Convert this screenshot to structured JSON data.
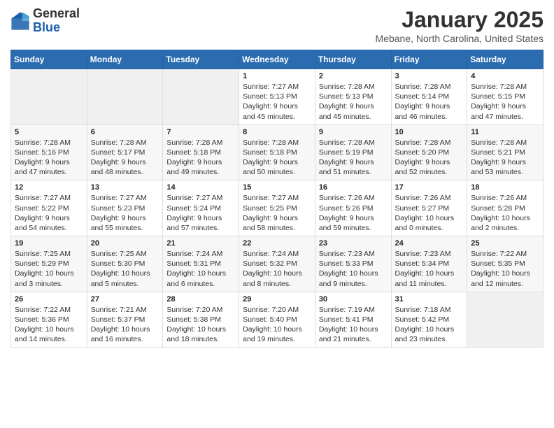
{
  "logo": {
    "general": "General",
    "blue": "Blue"
  },
  "header": {
    "title": "January 2025",
    "location": "Mebane, North Carolina, United States"
  },
  "weekdays": [
    "Sunday",
    "Monday",
    "Tuesday",
    "Wednesday",
    "Thursday",
    "Friday",
    "Saturday"
  ],
  "weeks": [
    [
      {
        "day": "",
        "info": ""
      },
      {
        "day": "",
        "info": ""
      },
      {
        "day": "",
        "info": ""
      },
      {
        "day": "1",
        "info": "Sunrise: 7:27 AM\nSunset: 5:13 PM\nDaylight: 9 hours and 45 minutes."
      },
      {
        "day": "2",
        "info": "Sunrise: 7:28 AM\nSunset: 5:13 PM\nDaylight: 9 hours and 45 minutes."
      },
      {
        "day": "3",
        "info": "Sunrise: 7:28 AM\nSunset: 5:14 PM\nDaylight: 9 hours and 46 minutes."
      },
      {
        "day": "4",
        "info": "Sunrise: 7:28 AM\nSunset: 5:15 PM\nDaylight: 9 hours and 47 minutes."
      }
    ],
    [
      {
        "day": "5",
        "info": "Sunrise: 7:28 AM\nSunset: 5:16 PM\nDaylight: 9 hours and 47 minutes."
      },
      {
        "day": "6",
        "info": "Sunrise: 7:28 AM\nSunset: 5:17 PM\nDaylight: 9 hours and 48 minutes."
      },
      {
        "day": "7",
        "info": "Sunrise: 7:28 AM\nSunset: 5:18 PM\nDaylight: 9 hours and 49 minutes."
      },
      {
        "day": "8",
        "info": "Sunrise: 7:28 AM\nSunset: 5:18 PM\nDaylight: 9 hours and 50 minutes."
      },
      {
        "day": "9",
        "info": "Sunrise: 7:28 AM\nSunset: 5:19 PM\nDaylight: 9 hours and 51 minutes."
      },
      {
        "day": "10",
        "info": "Sunrise: 7:28 AM\nSunset: 5:20 PM\nDaylight: 9 hours and 52 minutes."
      },
      {
        "day": "11",
        "info": "Sunrise: 7:28 AM\nSunset: 5:21 PM\nDaylight: 9 hours and 53 minutes."
      }
    ],
    [
      {
        "day": "12",
        "info": "Sunrise: 7:27 AM\nSunset: 5:22 PM\nDaylight: 9 hours and 54 minutes."
      },
      {
        "day": "13",
        "info": "Sunrise: 7:27 AM\nSunset: 5:23 PM\nDaylight: 9 hours and 55 minutes."
      },
      {
        "day": "14",
        "info": "Sunrise: 7:27 AM\nSunset: 5:24 PM\nDaylight: 9 hours and 57 minutes."
      },
      {
        "day": "15",
        "info": "Sunrise: 7:27 AM\nSunset: 5:25 PM\nDaylight: 9 hours and 58 minutes."
      },
      {
        "day": "16",
        "info": "Sunrise: 7:26 AM\nSunset: 5:26 PM\nDaylight: 9 hours and 59 minutes."
      },
      {
        "day": "17",
        "info": "Sunrise: 7:26 AM\nSunset: 5:27 PM\nDaylight: 10 hours and 0 minutes."
      },
      {
        "day": "18",
        "info": "Sunrise: 7:26 AM\nSunset: 5:28 PM\nDaylight: 10 hours and 2 minutes."
      }
    ],
    [
      {
        "day": "19",
        "info": "Sunrise: 7:25 AM\nSunset: 5:29 PM\nDaylight: 10 hours and 3 minutes."
      },
      {
        "day": "20",
        "info": "Sunrise: 7:25 AM\nSunset: 5:30 PM\nDaylight: 10 hours and 5 minutes."
      },
      {
        "day": "21",
        "info": "Sunrise: 7:24 AM\nSunset: 5:31 PM\nDaylight: 10 hours and 6 minutes."
      },
      {
        "day": "22",
        "info": "Sunrise: 7:24 AM\nSunset: 5:32 PM\nDaylight: 10 hours and 8 minutes."
      },
      {
        "day": "23",
        "info": "Sunrise: 7:23 AM\nSunset: 5:33 PM\nDaylight: 10 hours and 9 minutes."
      },
      {
        "day": "24",
        "info": "Sunrise: 7:23 AM\nSunset: 5:34 PM\nDaylight: 10 hours and 11 minutes."
      },
      {
        "day": "25",
        "info": "Sunrise: 7:22 AM\nSunset: 5:35 PM\nDaylight: 10 hours and 12 minutes."
      }
    ],
    [
      {
        "day": "26",
        "info": "Sunrise: 7:22 AM\nSunset: 5:36 PM\nDaylight: 10 hours and 14 minutes."
      },
      {
        "day": "27",
        "info": "Sunrise: 7:21 AM\nSunset: 5:37 PM\nDaylight: 10 hours and 16 minutes."
      },
      {
        "day": "28",
        "info": "Sunrise: 7:20 AM\nSunset: 5:38 PM\nDaylight: 10 hours and 18 minutes."
      },
      {
        "day": "29",
        "info": "Sunrise: 7:20 AM\nSunset: 5:40 PM\nDaylight: 10 hours and 19 minutes."
      },
      {
        "day": "30",
        "info": "Sunrise: 7:19 AM\nSunset: 5:41 PM\nDaylight: 10 hours and 21 minutes."
      },
      {
        "day": "31",
        "info": "Sunrise: 7:18 AM\nSunset: 5:42 PM\nDaylight: 10 hours and 23 minutes."
      },
      {
        "day": "",
        "info": ""
      }
    ]
  ]
}
